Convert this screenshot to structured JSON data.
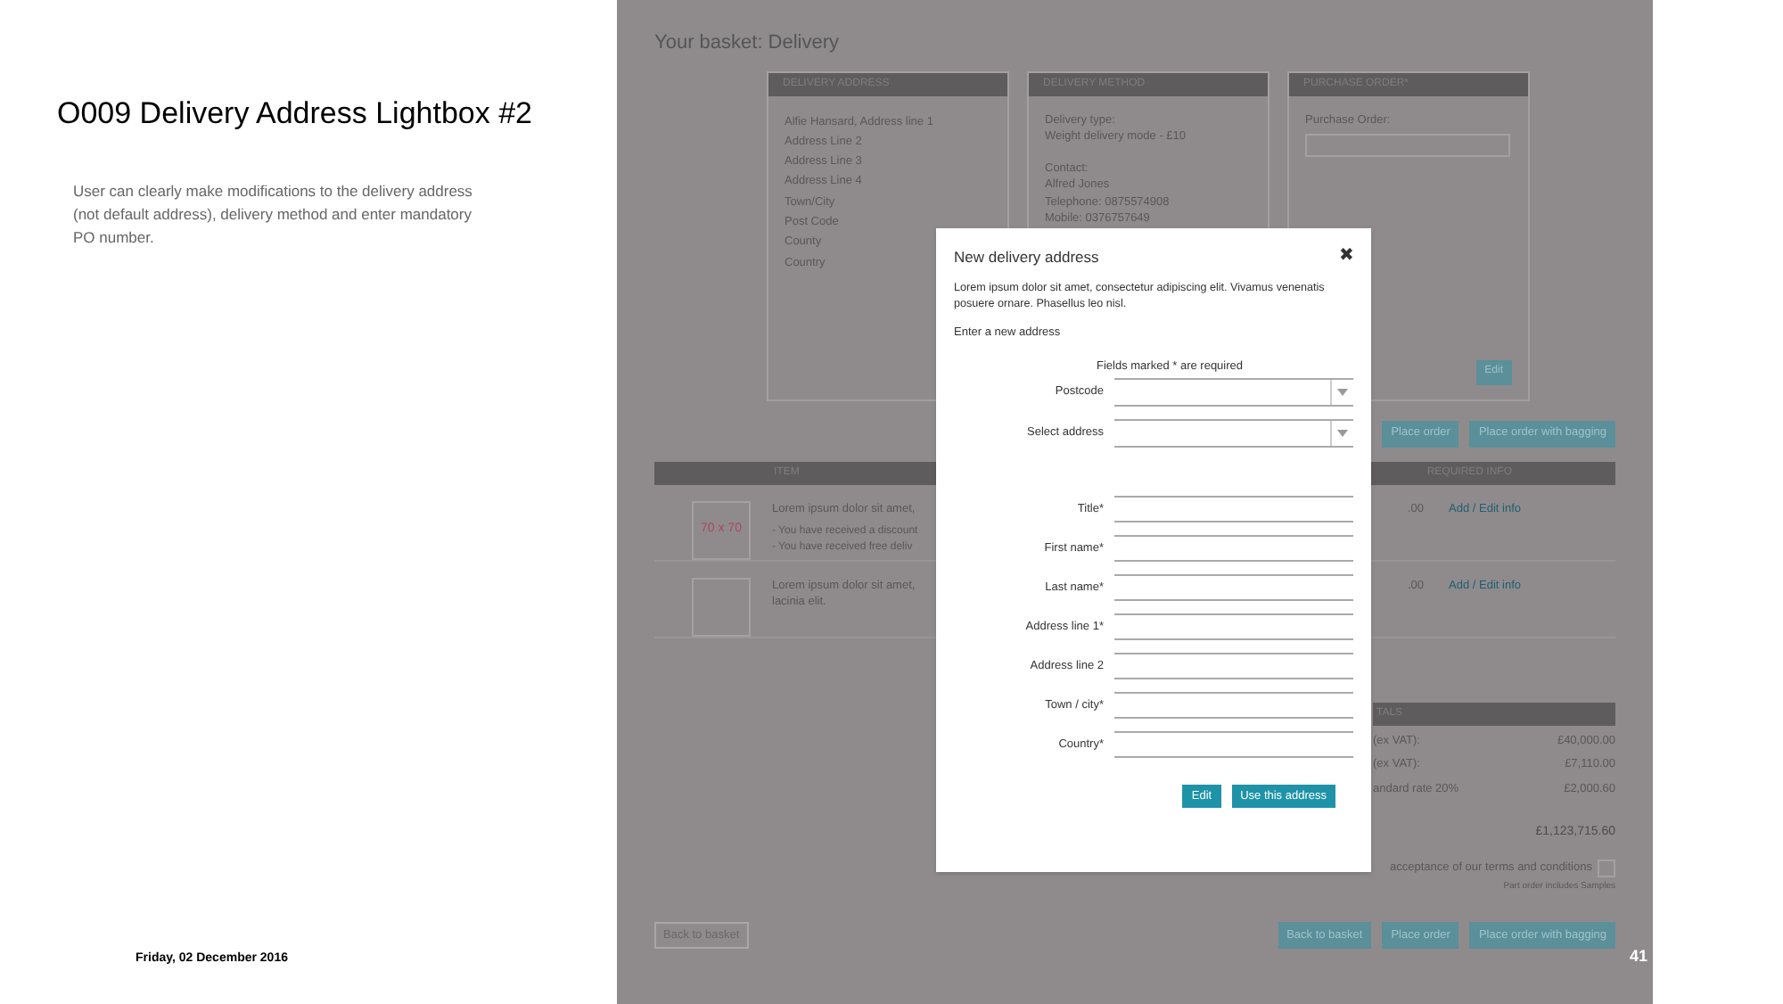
{
  "slide": {
    "title": "O009 Delivery Address Lightbox #2",
    "description": "User can clearly make modifications to the delivery address (not default address), delivery method and enter mandatory PO number.",
    "date": "Friday, 02 December 2016",
    "page_number": "41"
  },
  "screen": {
    "heading": "Your basket: Delivery",
    "cards": [
      {
        "kind": "text",
        "title": "DELIVERY ADDRESS",
        "paragraphs": [
          [
            "Alfie Hansard, Address line 1",
            "Address Line 2",
            "Address Line 3",
            "Address Line 4",
            "Town/City",
            "Post Code",
            "County",
            "Country"
          ]
        ]
      },
      {
        "kind": "text",
        "title": "DELIVERY METHOD",
        "paragraphs": [
          [
            "Delivery type:",
            "Weight delivery mode - £10"
          ],
          [
            "Contact:",
            "Alfred Jones",
            "Telephone: 0875574908",
            "Mobile: 0376757649"
          ]
        ]
      },
      {
        "kind": "form",
        "title": "PURCHASE ORDER*",
        "field_label": "Purchase Order:",
        "button": "Edit"
      }
    ],
    "actions": [
      "Place order",
      "Place order with bagging"
    ],
    "table": {
      "columns": [
        "ITEM",
        "REQUIRED INFO"
      ],
      "rows": [
        {
          "image_label": "70 x 70",
          "lines": [
            "Lorem ipsum dolor sit amet,"
          ],
          "notes": [
            "- You have received a discount",
            "- You have received free deliv"
          ],
          "price": ".00",
          "action": "Add / Edit info"
        },
        {
          "lines": [
            "Lorem ipsum dolor sit amet,",
            "lacinia elit."
          ],
          "price": ".00",
          "action": "Add / Edit info"
        }
      ]
    },
    "totals": {
      "title": "TALS",
      "rows": [
        {
          "label": "(ex VAT):",
          "value": "£40,000.00"
        },
        {
          "label": "(ex VAT):",
          "value": "£7,110.00"
        },
        {
          "label": "andard rate 20%",
          "value": "£2,000.60"
        }
      ],
      "total": "£1,123,715.60"
    },
    "terms": {
      "text": "acceptance of our terms and conditions",
      "checked": false
    },
    "note": "Part order includes Samples",
    "footer_buttons": [
      {
        "kind": "outline",
        "label": "Back to basket"
      },
      {
        "kind": "primary",
        "label": "Back to basket"
      },
      {
        "kind": "primary",
        "label": "Place order"
      },
      {
        "kind": "primary",
        "label": "Place order with bagging"
      }
    ]
  },
  "modal": {
    "title": "New delivery address",
    "close": "✖",
    "intro": "Lorem ipsum dolor sit amet, consectetur adipiscing elit. Vivamus venenatis posuere ornare. Phasellus leo nisl.",
    "subtitle": "Enter a new address",
    "required_note": "Fields marked * are required",
    "fields": [
      {
        "kind": "select",
        "label": "Postcode"
      },
      {
        "kind": "select",
        "label": "Select address"
      },
      {
        "kind": "text",
        "label": "Title*"
      },
      {
        "kind": "text",
        "label": "First name*"
      },
      {
        "kind": "text",
        "label": "Last name*"
      },
      {
        "kind": "text",
        "label": "Address line 1*"
      },
      {
        "kind": "text",
        "label": "Address line 2"
      },
      {
        "kind": "text",
        "label": "Town / city*"
      },
      {
        "kind": "text",
        "label": "Country*"
      }
    ],
    "buttons": [
      "Edit",
      "Use this address"
    ]
  }
}
